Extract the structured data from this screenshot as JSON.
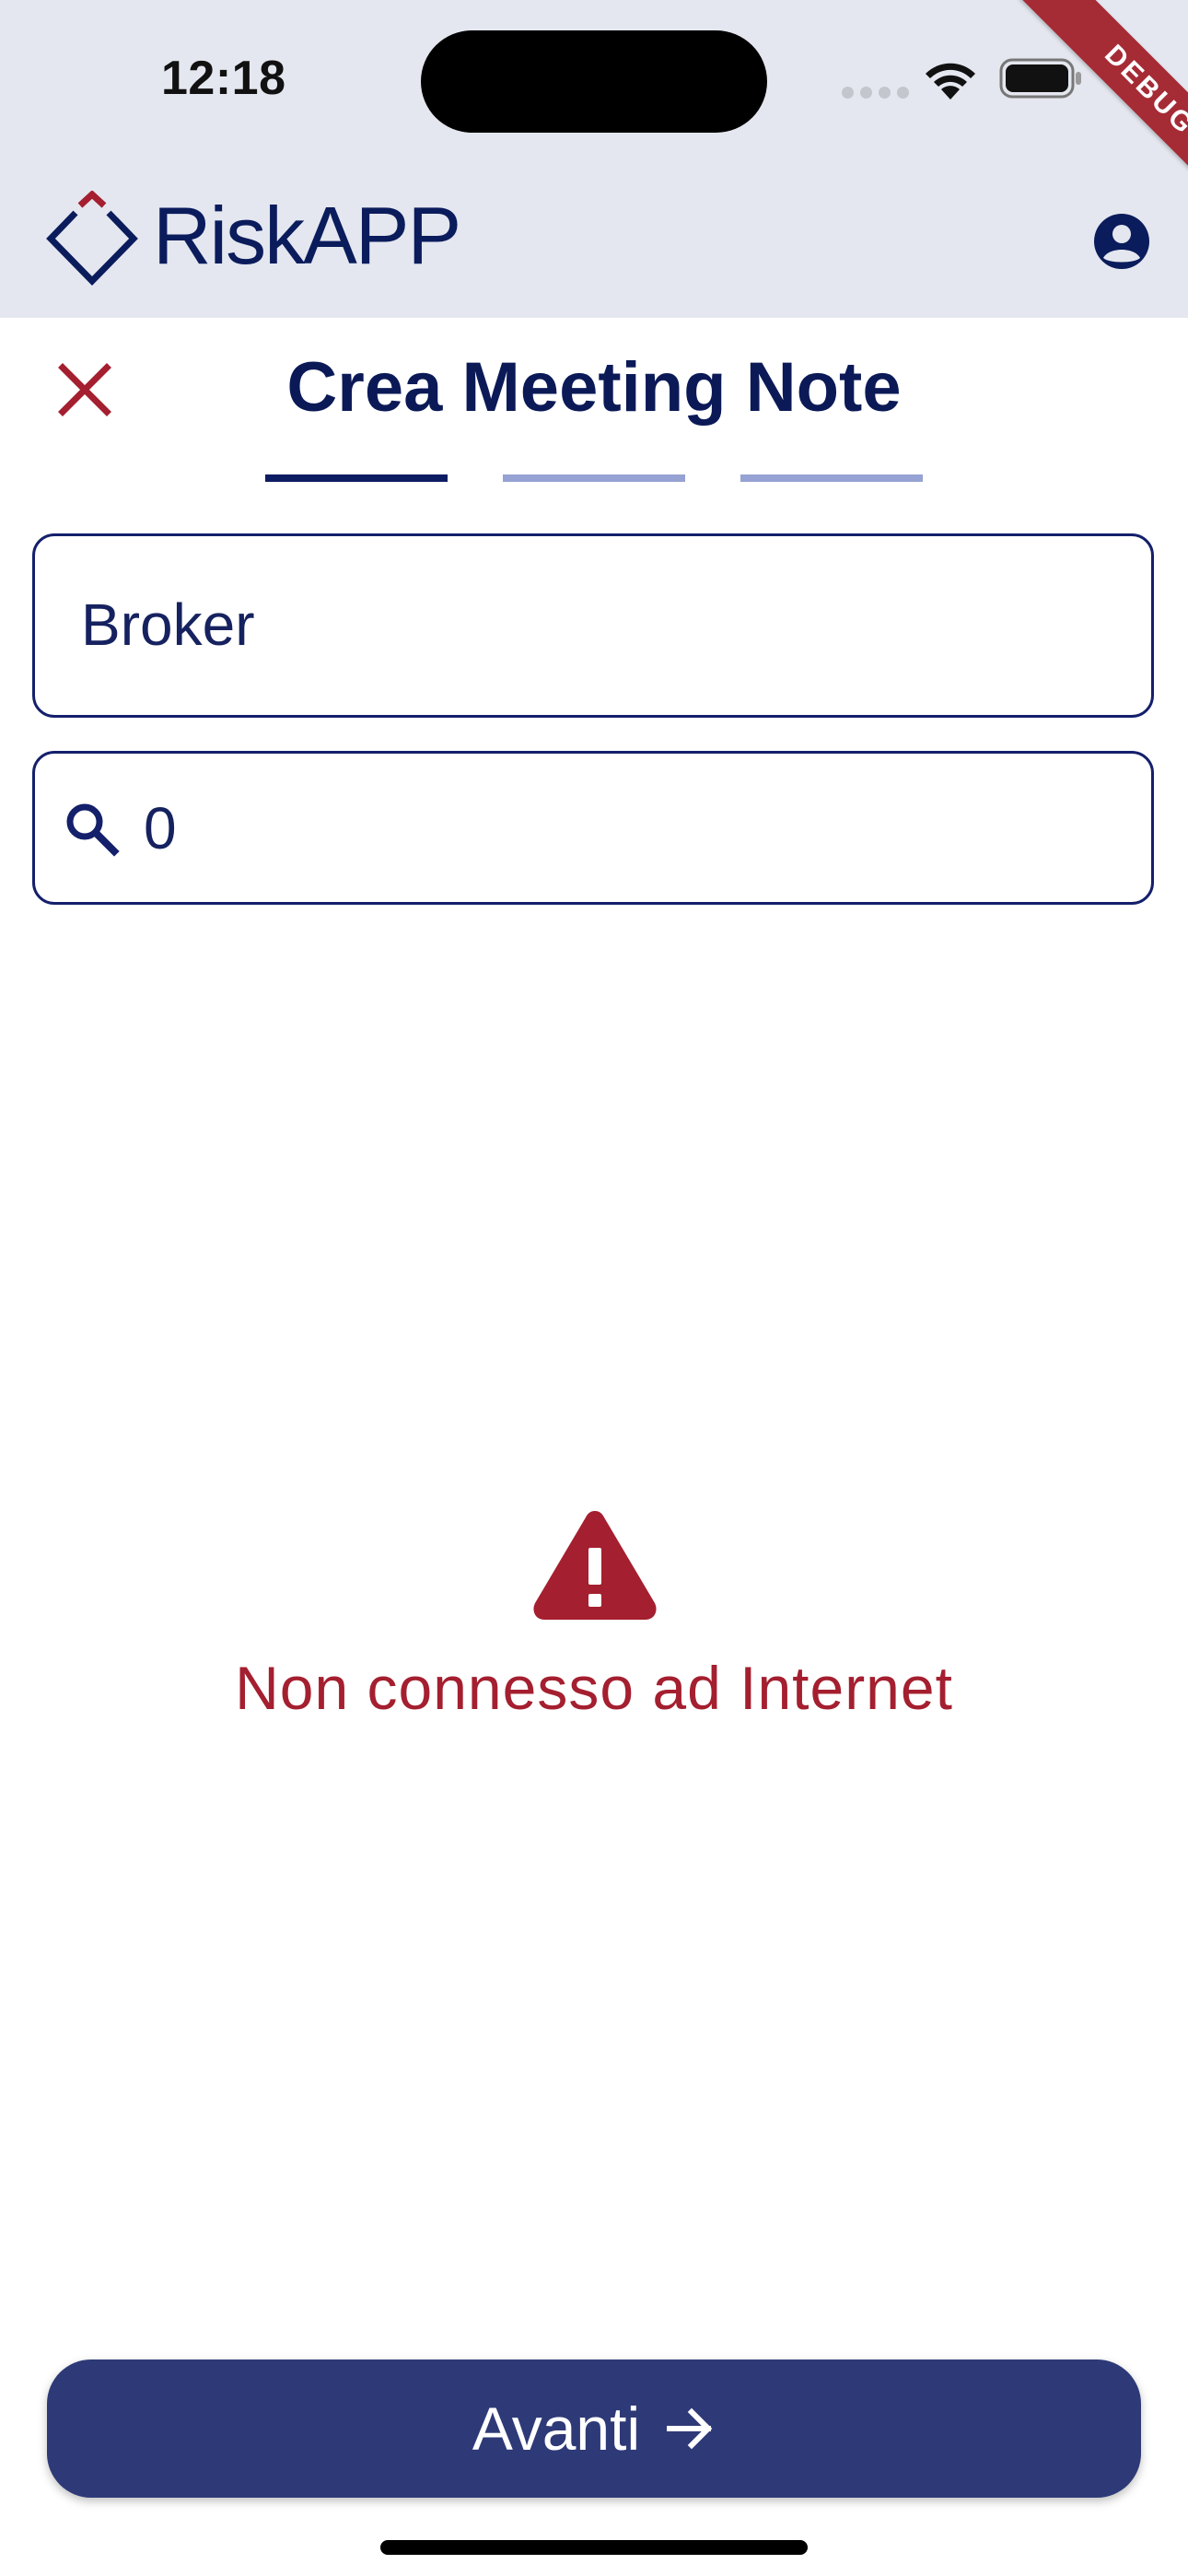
{
  "status_bar": {
    "time": "12:18"
  },
  "debug_banner": "DEBUG",
  "header": {
    "brand_name": "RiskAPP"
  },
  "page": {
    "title": "Crea Meeting Note",
    "current_step": 1,
    "total_steps": 3
  },
  "form": {
    "broker_value": "Broker",
    "search_value": "0"
  },
  "error": {
    "message": "Non connesso ad Internet"
  },
  "footer": {
    "next_label": "Avanti"
  },
  "colors": {
    "primary": "#0b1c5c",
    "accent_red": "#a41f2f",
    "button": "#2e3a77",
    "step_inactive": "#95a2d3",
    "header_bg": "#e4e7ef"
  },
  "icons": [
    "cellular-signal-icon",
    "wifi-icon",
    "battery-icon",
    "riskapp-logo-icon",
    "account-circle-icon",
    "close-icon",
    "search-icon",
    "warning-icon",
    "arrow-right-icon"
  ]
}
